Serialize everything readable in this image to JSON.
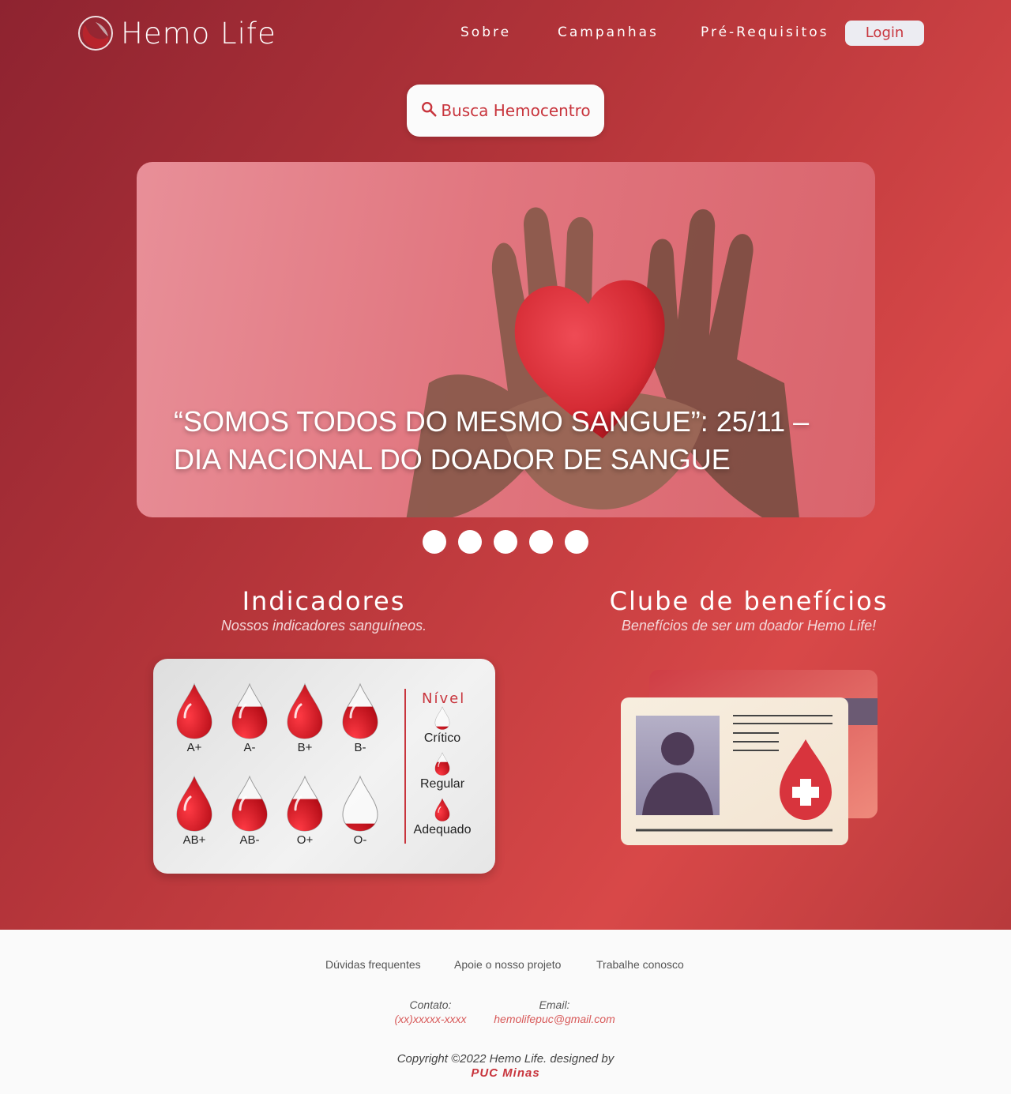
{
  "brand": {
    "name": "Hemo Life",
    "accent": "#c8353d"
  },
  "nav": {
    "links": [
      "Sobre",
      "Campanhas",
      "Pré-Requisitos"
    ],
    "login_label": "Login"
  },
  "search": {
    "label": "Busca Hemocentro",
    "icon": "search-icon"
  },
  "carousel": {
    "caption_line1": "“SOMOS TODOS DO MESMO SANGUE”: 25/11 –",
    "caption_line2": "DIA NACIONAL DO DOADOR DE SANGUE",
    "dot_count": 5
  },
  "indicators": {
    "title": "Indicadores",
    "subtitle": "Nossos indicadores sanguíneos.",
    "blood_types": [
      {
        "type": "A+",
        "fill": 1.0
      },
      {
        "type": "A-",
        "fill": 0.6
      },
      {
        "type": "B+",
        "fill": 1.0
      },
      {
        "type": "B-",
        "fill": 0.6
      },
      {
        "type": "AB+",
        "fill": 1.0
      },
      {
        "type": "AB-",
        "fill": 0.6
      },
      {
        "type": "O+",
        "fill": 0.6
      },
      {
        "type": "O-",
        "fill": 0.15
      }
    ],
    "level_title": "Nível",
    "levels": [
      {
        "label": "Crítico",
        "fill": 0.15
      },
      {
        "label": "Regular",
        "fill": 0.6
      },
      {
        "label": "Adequado",
        "fill": 1.0
      }
    ]
  },
  "benefits": {
    "title": "Clube de benefícios",
    "subtitle": "Benefícios de ser um doador Hemo Life!"
  },
  "footer": {
    "links": [
      "Dúvidas frequentes",
      "Apoie o nosso projeto",
      "Trabalhe conosco"
    ],
    "contact_label": "Contato:",
    "contact_value": "(xx)xxxxx-xxxx",
    "email_label": "Email:",
    "email_value": "hemolifepuc@gmail.com",
    "copyright": "Copyright ©2022 Hemo Life. designed by",
    "designer": "PUC Minas"
  }
}
